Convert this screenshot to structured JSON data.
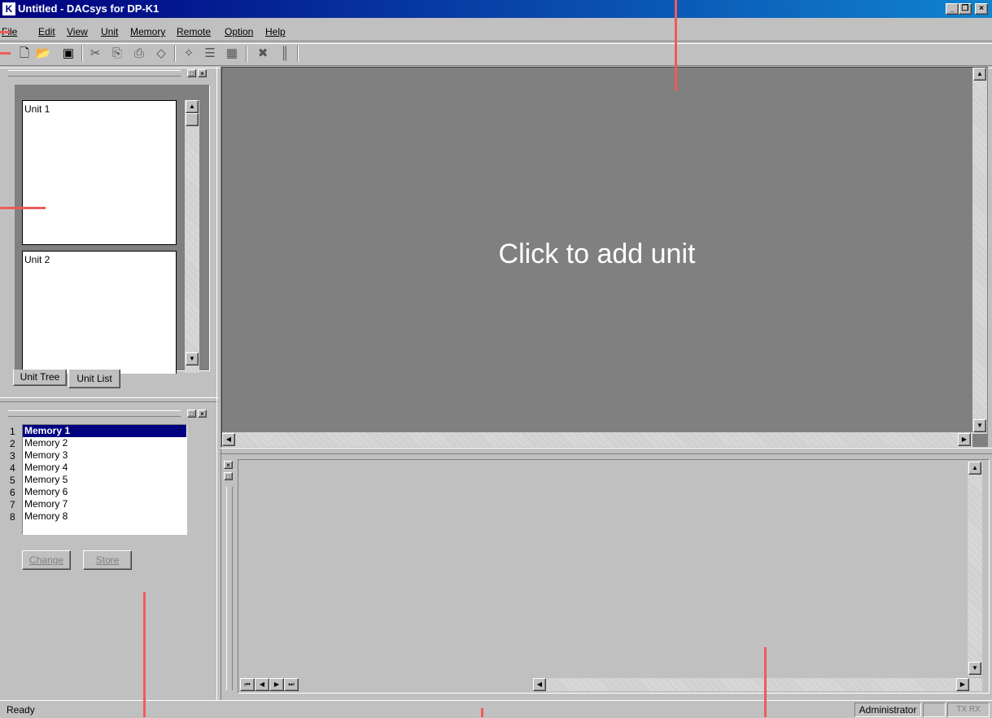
{
  "window": {
    "title": "Untitled - DACsys for DP-K1"
  },
  "menu": [
    "File",
    "Edit",
    "View",
    "Unit",
    "Memory",
    "Remote",
    "Option",
    "Help"
  ],
  "toolbar": [
    "new-doc",
    "open-folder",
    "save-disk",
    "cut",
    "copy",
    "paste",
    "erase",
    "wand",
    "list",
    "grid",
    "disconnect",
    "columns"
  ],
  "unit_panel": {
    "units": [
      "Unit 1",
      "Unit 2"
    ],
    "tabs": [
      "Unit Tree",
      "Unit List"
    ],
    "active_tab": "Unit List"
  },
  "memory_panel": {
    "items": [
      {
        "num": "1",
        "label": "Memory 1"
      },
      {
        "num": "2",
        "label": "Memory 2"
      },
      {
        "num": "3",
        "label": "Memory 3"
      },
      {
        "num": "4",
        "label": "Memory 4"
      },
      {
        "num": "5",
        "label": "Memory 5"
      },
      {
        "num": "6",
        "label": "Memory 6"
      },
      {
        "num": "7",
        "label": "Memory 7"
      },
      {
        "num": "8",
        "label": "Memory 8"
      }
    ],
    "selected": "Memory 1",
    "buttons": {
      "change": "Change",
      "store": "Store"
    }
  },
  "main_view": {
    "hint": "Click to add unit",
    "background": "#808080"
  },
  "status": {
    "text": "Ready",
    "user": "Administrator",
    "tx": "TX",
    "rx": "RX"
  },
  "colors": {
    "title_start": "#000080",
    "title_end": "#1084d0",
    "selection": "#000080",
    "annotation": "#f05a5a"
  }
}
